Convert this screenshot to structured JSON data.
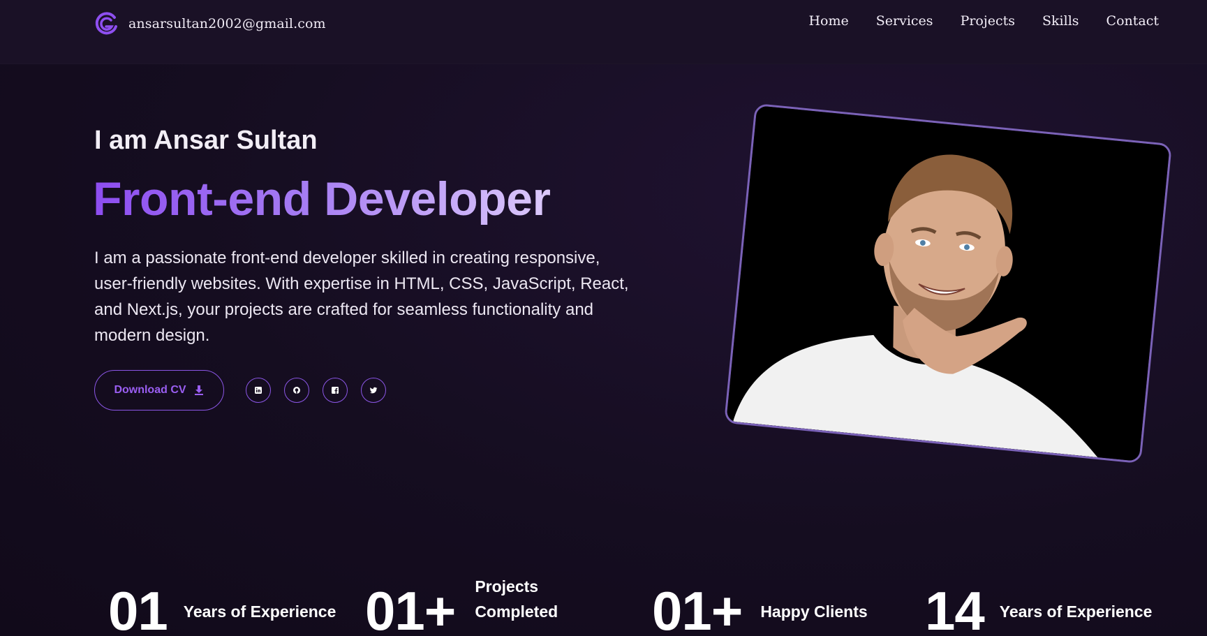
{
  "header": {
    "email": "ansarsultan2002@gmail.com",
    "nav": [
      "Home",
      "Services",
      "Projects",
      "Skills",
      "Contact"
    ]
  },
  "hero": {
    "greeting": "I am Ansar Sultan",
    "role": "Front-end Developer",
    "bio": "I am a passionate front-end developer skilled in creating responsive, user-friendly websites. With expertise in HTML, CSS, JavaScript, React, and Next.js, your projects are crafted for seamless functionality and modern design.",
    "download_label": "Download CV",
    "socials": [
      "linkedin-icon",
      "github-icon",
      "facebook-icon",
      "twitter-icon"
    ]
  },
  "stats": [
    {
      "number": "01",
      "label": "Years of Experience"
    },
    {
      "number": "01+",
      "label": "Projects Completed"
    },
    {
      "number": "01+",
      "label": "Happy Clients"
    },
    {
      "number": "14",
      "label": "Years of Experience"
    }
  ],
  "colors": {
    "background": "#150d20",
    "accent": "#8d4df0",
    "frame": "#7b62b8"
  }
}
